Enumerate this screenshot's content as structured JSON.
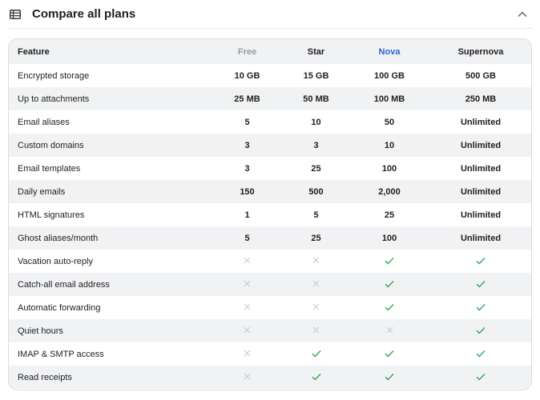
{
  "header": {
    "title": "Compare all plans",
    "icon": "table-icon",
    "toggle_icon": "chevron-up-icon"
  },
  "colors": {
    "check": "#34a853",
    "cross": "#c8c8c8",
    "nova": "#2f63d6",
    "free": "#9a9a9a"
  },
  "table": {
    "columns": [
      "Feature",
      "Free",
      "Star",
      "Nova",
      "Supernova"
    ],
    "rows": [
      {
        "feature": "Encrypted storage",
        "values": [
          "10 GB",
          "15 GB",
          "100 GB",
          "500 GB"
        ]
      },
      {
        "feature": "Up to attachments",
        "values": [
          "25 MB",
          "50 MB",
          "100 MB",
          "250 MB"
        ]
      },
      {
        "feature": "Email aliases",
        "values": [
          "5",
          "10",
          "50",
          "Unlimited"
        ]
      },
      {
        "feature": "Custom domains",
        "values": [
          "3",
          "3",
          "10",
          "Unlimited"
        ]
      },
      {
        "feature": "Email templates",
        "values": [
          "3",
          "25",
          "100",
          "Unlimited"
        ]
      },
      {
        "feature": "Daily emails",
        "values": [
          "150",
          "500",
          "2,000",
          "Unlimited"
        ]
      },
      {
        "feature": "HTML signatures",
        "values": [
          "1",
          "5",
          "25",
          "Unlimited"
        ]
      },
      {
        "feature": "Ghost aliases/month",
        "values": [
          "5",
          "25",
          "100",
          "Unlimited"
        ]
      },
      {
        "feature": "Vacation auto-reply",
        "icons": [
          "cross-icon",
          "cross-icon",
          "check-icon",
          "check-icon"
        ]
      },
      {
        "feature": "Catch-all email address",
        "icons": [
          "cross-icon",
          "cross-icon",
          "check-icon",
          "check-icon"
        ]
      },
      {
        "feature": "Automatic forwarding",
        "icons": [
          "cross-icon",
          "cross-icon",
          "check-icon",
          "check-icon"
        ]
      },
      {
        "feature": "Quiet hours",
        "icons": [
          "cross-icon",
          "cross-icon",
          "cross-icon",
          "check-icon"
        ]
      },
      {
        "feature": "IMAP & SMTP access",
        "icons": [
          "cross-icon",
          "check-icon",
          "check-icon",
          "check-icon"
        ]
      },
      {
        "feature": "Read receipts",
        "icons": [
          "cross-icon",
          "check-icon",
          "check-icon",
          "check-icon"
        ]
      }
    ]
  }
}
